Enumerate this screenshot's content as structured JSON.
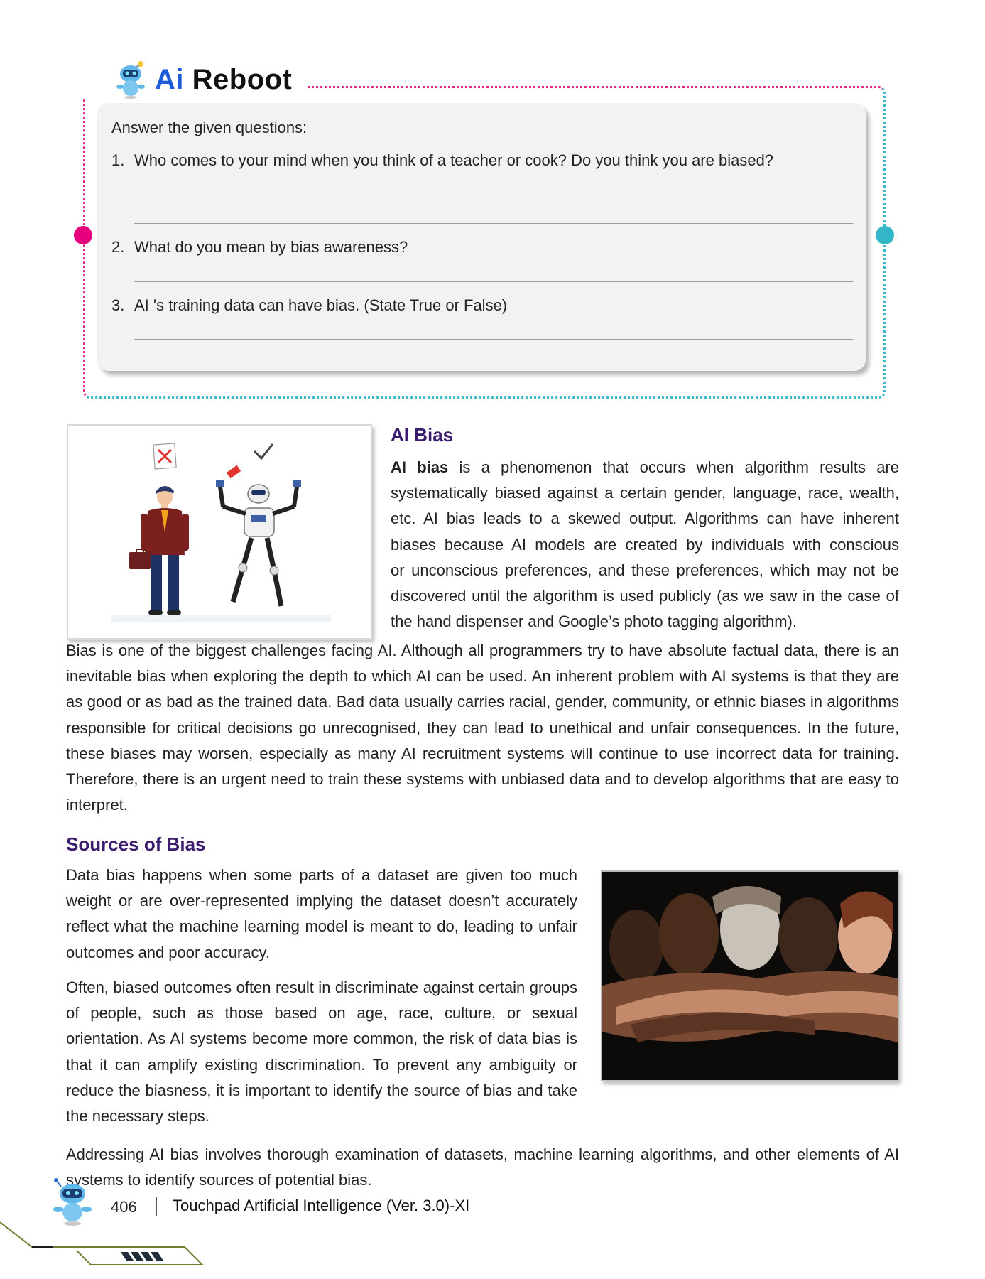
{
  "reboot": {
    "title_ai": "Ai",
    "title_rest": "Reboot",
    "intro": "Answer the given questions:",
    "questions": [
      {
        "num": "1.",
        "text": "Who comes to your mind when you think of a teacher or cook? Do you think you are biased?"
      },
      {
        "num": "2.",
        "text": "What do you mean by bias awareness?"
      },
      {
        "num": "3.",
        "text": "AI 's training data can have bias. (State True or False)"
      }
    ]
  },
  "ai_bias": {
    "heading": "AI Bias",
    "bold_lead": "AI bias",
    "para1_lines": [
      " is a phenomenon that occurs when algorithm results are",
      "systematically biased against a certain gender, language, race, wealth,",
      "etc. AI bias leads to a skewed output. Algorithms can have inherent",
      "biases because AI models are created by individuals with conscious",
      "or unconscious preferences, and these preferences, which may not be",
      "discovered until the algorithm is used publicly (as we saw in the case of",
      "the hand dispenser and Google’s photo tagging algorithm)."
    ],
    "para2": "Bias is one of the biggest challenges facing AI. Although all programmers try to have absolute factual data, there is an inevitable bias when exploring the depth to which AI can be used. An inherent problem with AI systems is that they are as good or as bad as the trained data. Bad data usually carries racial, gender, community, or ethnic biases in algorithms responsible for critical decisions go unrecognised, they can lead to unethical and unfair consequences. In the future, these biases may worsen, especially as many AI recruitment systems will continue to use incorrect data for training. Therefore, there is an urgent need to train these systems with unbiased data and to develop algorithms that are easy to interpret."
  },
  "sources": {
    "heading": "Sources of Bias",
    "para1": "Data bias happens when some parts of a dataset are given too much weight or are over-represented implying the dataset doesn’t accurately reflect what the machine learning model is meant to do, leading to unfair outcomes and poor accuracy.",
    "para2": "Often, biased outcomes often result in discriminate against certain groups of people, such as those based on age, race, culture, or sexual orientation. As AI systems become more common, the risk of data bias is that it can amplify existing discrimination. To prevent any ambiguity or reduce the biasness, it is important to identify the source of bias and take the necessary steps.",
    "para3": "Addressing AI bias involves thorough examination of datasets, machine learning algorithms, and other elements of AI systems to identify sources of potential bias."
  },
  "footer": {
    "page_number": "406",
    "book_title": "Touchpad Artificial Intelligence (Ver. 3.0)-XI"
  },
  "colors": {
    "heading": "#3b1c6e",
    "accent_pink": "#e6007e",
    "accent_teal": "#34b7c9",
    "logo_blue": "#1e5bd8"
  },
  "icons": [
    "robot-mascot-icon",
    "cross-mark-icon",
    "check-mark-icon"
  ]
}
